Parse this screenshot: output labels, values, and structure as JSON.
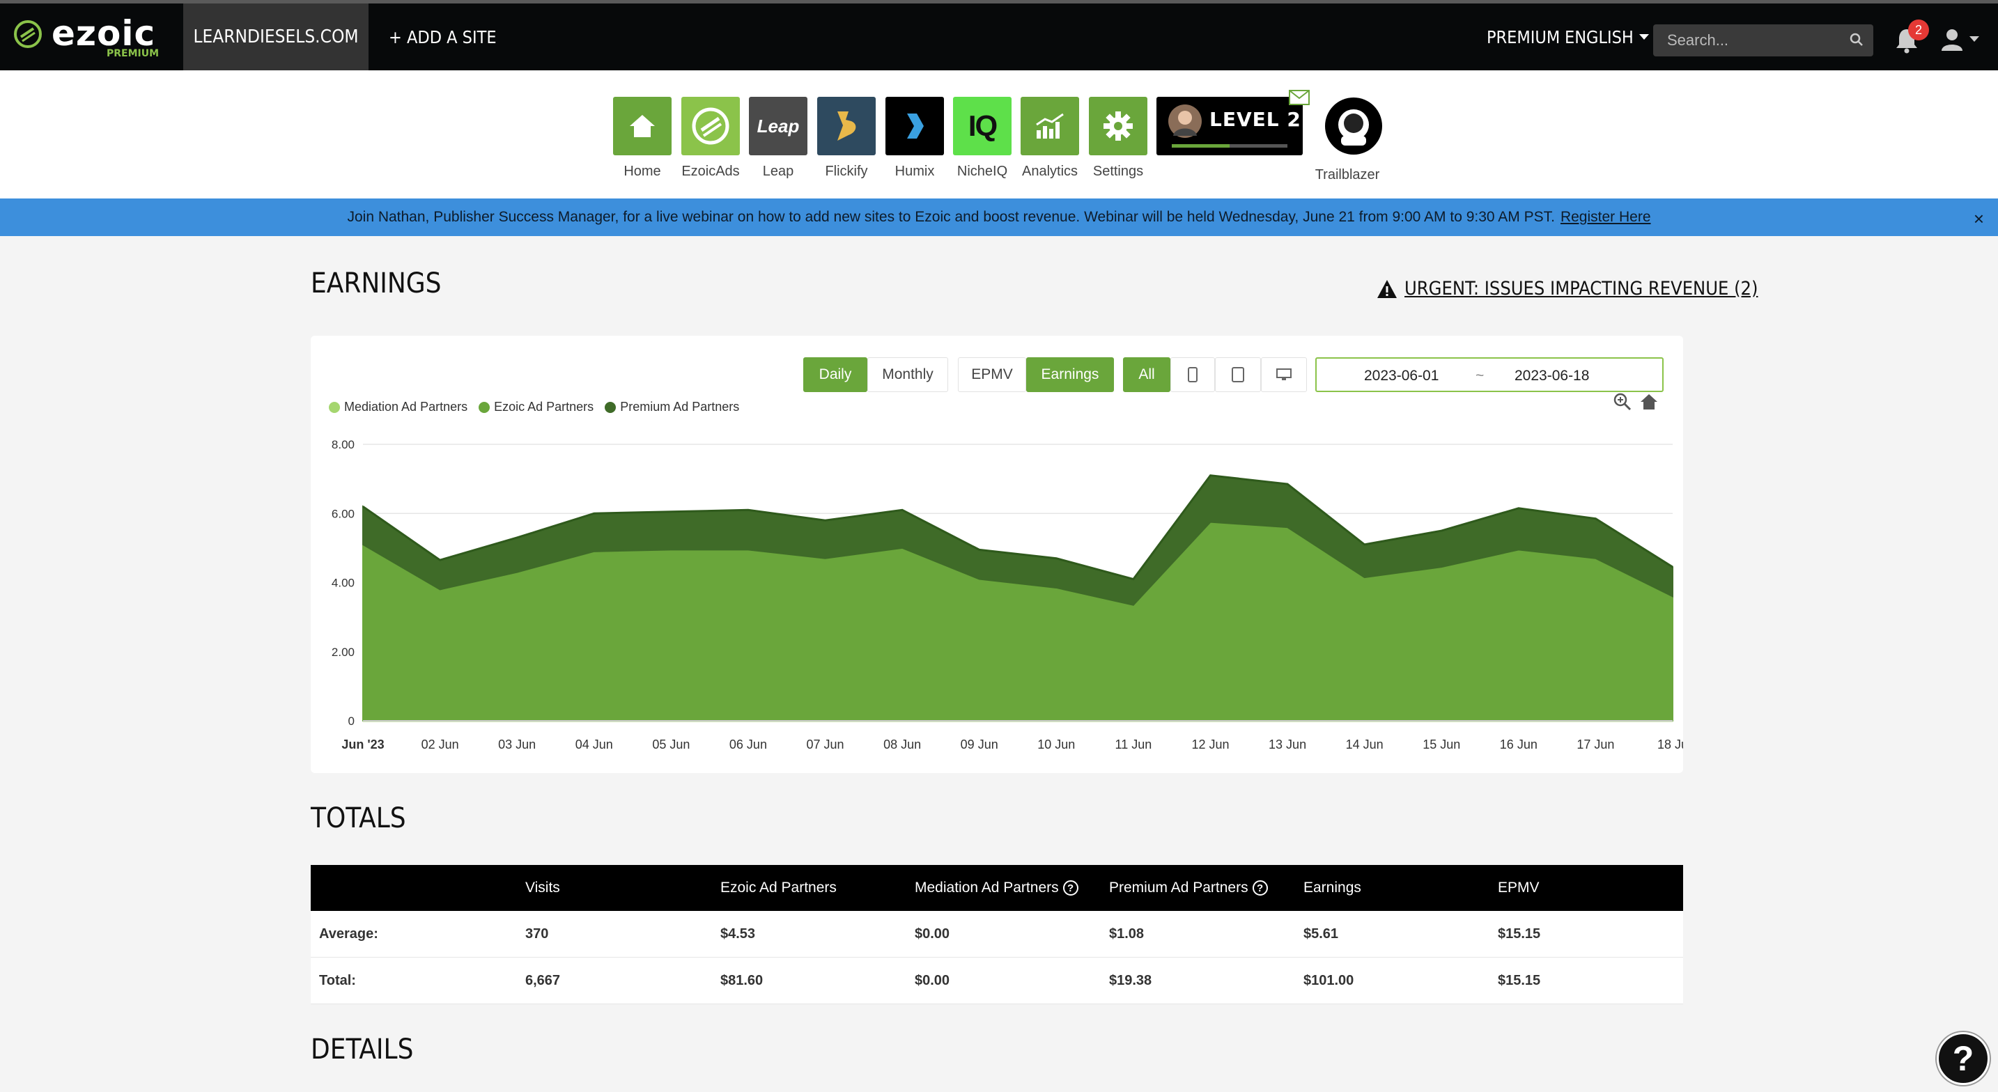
{
  "topbar": {
    "logo_text": "ezoic",
    "logo_sub": "PREMIUM",
    "site": "LEARNDIESELS.COM",
    "add_site": "+ ADD A SITE",
    "premium": "PREMIUM",
    "language": "ENGLISH",
    "search_placeholder": "Search...",
    "notifications": "2"
  },
  "apps": [
    {
      "label": "Home",
      "color": "#6aa63b",
      "icon": "home-icon"
    },
    {
      "label": "EzoicAds",
      "color": "#8bc34a",
      "icon": "ezoic-icon"
    },
    {
      "label": "Leap",
      "color": "#4a4a4a",
      "icon": "leap-icon",
      "text": "Leap"
    },
    {
      "label": "Flickify",
      "color": "#2e4a5f",
      "icon": "flickify-icon"
    },
    {
      "label": "Humix",
      "color": "#000000",
      "icon": "humix-icon"
    },
    {
      "label": "NicheIQ",
      "color": "#5ee04a",
      "icon": "nicheiq-icon",
      "text": "IQ"
    },
    {
      "label": "Analytics",
      "color": "#6aa63b",
      "icon": "analytics-icon"
    },
    {
      "label": "Settings",
      "color": "#6aa63b",
      "icon": "gear-icon"
    }
  ],
  "level": {
    "text": "LEVEL 2",
    "progress": 0.5
  },
  "trailblazer": "Trailblazer",
  "banner": {
    "text": "Join Nathan, Publisher Success Manager, for a live webinar on how to add new sites to Ezoic and boost revenue. Webinar will be held Wednesday, June 21 from 9:00 AM to 9:30 AM PST.",
    "link": "Register Here",
    "close": "×"
  },
  "earnings": {
    "title": "EARNINGS",
    "urgent": "URGENT: ISSUES IMPACTING REVENUE (2)",
    "period_buttons": [
      "Daily",
      "Monthly"
    ],
    "metric_buttons": [
      "EPMV",
      "Earnings"
    ],
    "device_all": "All",
    "date_from": "2023-06-01",
    "date_sep": "~",
    "date_to": "2023-06-18"
  },
  "chart_data": {
    "type": "area",
    "stacked": true,
    "x": [
      "Jun '23",
      "02 Jun",
      "03 Jun",
      "04 Jun",
      "05 Jun",
      "06 Jun",
      "07 Jun",
      "08 Jun",
      "09 Jun",
      "10 Jun",
      "11 Jun",
      "12 Jun",
      "13 Jun",
      "14 Jun",
      "15 Jun",
      "16 Jun",
      "17 Jun",
      "18 Ju"
    ],
    "yticks": [
      "0",
      "2.00",
      "4.00",
      "6.00",
      "8.00"
    ],
    "ylim": [
      0,
      8
    ],
    "legend_position": "top-left",
    "series": [
      {
        "name": "Mediation Ad Partners",
        "color": "#a5d66f",
        "values": [
          0,
          0,
          0,
          0,
          0,
          0,
          0,
          0,
          0,
          0,
          0,
          0,
          0,
          0,
          0,
          0,
          0,
          0
        ]
      },
      {
        "name": "Ezoic Ad Partners",
        "color": "#6aa63b",
        "values": [
          5.1,
          3.8,
          4.3,
          4.9,
          4.95,
          4.95,
          4.7,
          5.0,
          4.1,
          3.85,
          3.35,
          5.75,
          5.6,
          4.15,
          4.45,
          4.95,
          4.7,
          3.6
        ]
      },
      {
        "name": "Premium Ad Partners",
        "color": "#3f6b28",
        "values": [
          1.1,
          0.85,
          1.0,
          1.1,
          1.1,
          1.15,
          1.1,
          1.1,
          0.85,
          0.85,
          0.75,
          1.35,
          1.25,
          0.95,
          1.05,
          1.2,
          1.15,
          0.85
        ]
      }
    ]
  },
  "totals": {
    "title": "TOTALS",
    "headers": [
      "Visits",
      "Ezoic Ad Partners",
      "Mediation Ad Partners",
      "Premium Ad Partners",
      "Earnings",
      "EPMV"
    ],
    "rows": [
      {
        "label": "Average:",
        "values": [
          "370",
          "$4.53",
          "$0.00",
          "$1.08",
          "$5.61",
          "$15.15"
        ]
      },
      {
        "label": "Total:",
        "values": [
          "6,667",
          "$81.60",
          "$0.00",
          "$19.38",
          "$101.00",
          "$15.15"
        ]
      }
    ]
  },
  "details": {
    "title": "DETAILS"
  },
  "help_fab": "?"
}
